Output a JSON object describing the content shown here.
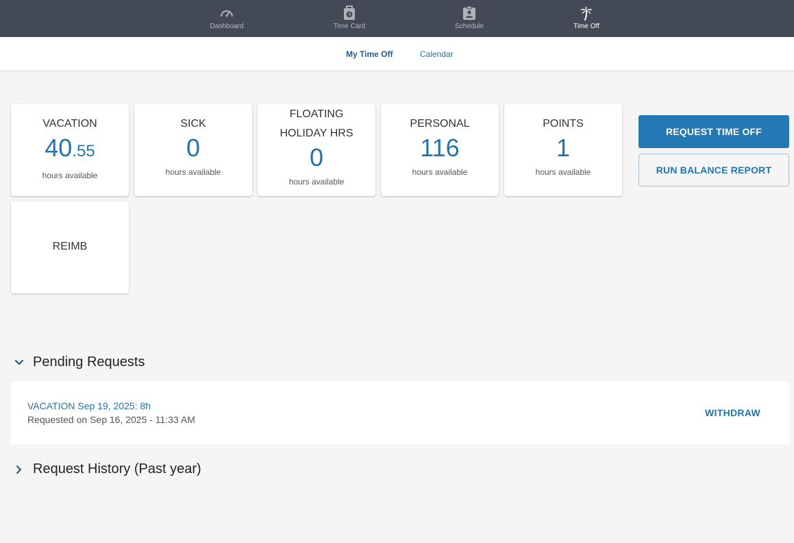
{
  "nav": {
    "items": [
      {
        "label": "Dashboard",
        "icon": "speedometer-icon",
        "active": false
      },
      {
        "label": "Time Card",
        "icon": "time-card-icon",
        "active": false
      },
      {
        "label": "Schedule",
        "icon": "schedule-badge-icon",
        "active": false
      },
      {
        "label": "Time Off",
        "icon": "palm-tree-icon",
        "active": true
      }
    ]
  },
  "subnav": {
    "tabs": [
      {
        "label": "My Time Off",
        "active": true
      },
      {
        "label": "Calendar",
        "active": false
      }
    ]
  },
  "balances": [
    {
      "title": "VACATION",
      "value_int": "40",
      "value_dec": ".55",
      "sub": "hours available"
    },
    {
      "title": "SICK",
      "value_int": "0",
      "value_dec": "",
      "sub": "hours available"
    },
    {
      "title_line1": "FLOATING",
      "title_line2": "HOLIDAY HRS",
      "value_int": "0",
      "value_dec": "",
      "sub": "hours available"
    },
    {
      "title": "PERSONAL",
      "value_int": "116",
      "value_dec": "",
      "sub": "hours available"
    },
    {
      "title": "POINTS",
      "value_int": "1",
      "value_dec": "",
      "sub": "hours available"
    },
    {
      "title": "REIMB"
    }
  ],
  "actions": {
    "request_label": "REQUEST TIME OFF",
    "report_label": "RUN BALANCE REPORT"
  },
  "pending": {
    "title": "Pending Requests",
    "expanded": true,
    "items": [
      {
        "title": "VACATION Sep 19, 2025: 8h",
        "meta": "Requested on Sep 16, 2025 - 11:33 AM",
        "action": "WITHDRAW"
      }
    ]
  },
  "history": {
    "title": "Request History (Past year)",
    "expanded": false
  },
  "colors": {
    "nav_bg": "#434a56",
    "accent": "#2474ab",
    "primary_button": "#2279b3",
    "page_bg": "#f5f5f5"
  }
}
